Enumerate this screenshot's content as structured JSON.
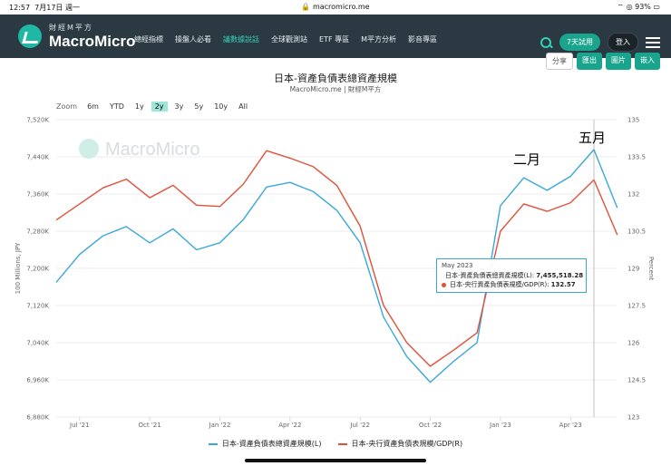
{
  "status": {
    "time": "12:57",
    "date": "7月17日 週一",
    "url": "macromicro.me",
    "battery": "93%"
  },
  "nav": {
    "brand_cn": "財經M平方",
    "brand_en": "MacroMicro",
    "menu": [
      "總經指標",
      "操盤人必看",
      "議數據說話",
      "全球觀測站",
      "ETF 專區",
      "M平方分析",
      "影音專區"
    ],
    "trial_label": "7天試用",
    "login_label": "登入"
  },
  "toolbar": {
    "share": "分享",
    "export": "匯出",
    "image": "圖片",
    "embed": "嵌入"
  },
  "zoom": {
    "label": "Zoom",
    "options": [
      "6m",
      "YTD",
      "1y",
      "2y",
      "3y",
      "5y",
      "10y",
      "All"
    ],
    "selected": "2y"
  },
  "watermark": "MacroMicro",
  "annotations": {
    "feb": "二月",
    "may": "五月"
  },
  "tooltip": {
    "date": "May 2023",
    "row1_label": "日本-資產負債表總資產規模(L): ",
    "row1_value": "7,455,518.28",
    "row2_label": "日本-央行資產負債表規模/GDP(R): ",
    "row2_value": "132.57"
  },
  "colors": {
    "series_left": "#3aa7d9",
    "series_right": "#e0503a",
    "accent": "#1aa48e",
    "nav_bg": "#2b3a42"
  },
  "chart_data": {
    "type": "line",
    "title": "日本-資產負債表總資產規模",
    "subtitle": "MacroMicro.me | 財經M平方",
    "ylabel_left": "100 Millions, JPY",
    "ylabel_right": "Percent",
    "x_ticks": [
      "Jul '21",
      "Oct '21",
      "Jan '22",
      "Apr '22",
      "Jul '22",
      "Oct '22",
      "Jan '23",
      "Apr '23"
    ],
    "x_start": "2021-06",
    "ylim_left": [
      6880000,
      7520000
    ],
    "yticks_left": [
      "6,880K",
      "6,960K",
      "7,040K",
      "7,120K",
      "7,200K",
      "7,280K",
      "7,360K",
      "7,440K",
      "7,520K"
    ],
    "ylim_right": [
      123,
      135
    ],
    "yticks_right": [
      "123",
      "124.5",
      "126",
      "127.5",
      "129",
      "130.5",
      "132",
      "133.5",
      "135"
    ],
    "series": [
      {
        "name": "日本-資產負債表總資產規模(L)",
        "axis": "left",
        "x": [
          "2021-06",
          "2021-07",
          "2021-08",
          "2021-09",
          "2021-10",
          "2021-11",
          "2021-12",
          "2022-01",
          "2022-02",
          "2022-03",
          "2022-04",
          "2022-05",
          "2022-06",
          "2022-07",
          "2022-08",
          "2022-09",
          "2022-10",
          "2022-11",
          "2022-12",
          "2023-01",
          "2023-02",
          "2023-03",
          "2023-04",
          "2023-05",
          "2023-06"
        ],
        "values": [
          7170000,
          7230000,
          7270000,
          7290000,
          7255000,
          7285000,
          7240000,
          7255000,
          7305000,
          7375000,
          7385000,
          7365000,
          7325000,
          7255000,
          7095000,
          7010000,
          6955000,
          7000000,
          7040000,
          7335000,
          7395000,
          7368000,
          7398000,
          7455518.28,
          7330000
        ]
      },
      {
        "name": "日本-央行資產負債表規模/GDP(R)",
        "axis": "right",
        "x": [
          "2021-06",
          "2021-07",
          "2021-08",
          "2021-09",
          "2021-10",
          "2021-11",
          "2021-12",
          "2022-01",
          "2022-02",
          "2022-03",
          "2022-04",
          "2022-05",
          "2022-06",
          "2022-07",
          "2022-08",
          "2022-09",
          "2022-10",
          "2022-11",
          "2022-12",
          "2023-01",
          "2023-02",
          "2023-03",
          "2023-04",
          "2023-05",
          "2023-06"
        ],
        "values": [
          130.95,
          131.6,
          132.25,
          132.6,
          131.85,
          132.35,
          131.55,
          131.5,
          132.4,
          133.75,
          133.45,
          133.1,
          132.35,
          130.7,
          127.5,
          126.0,
          125.05,
          125.7,
          126.4,
          130.5,
          131.6,
          131.3,
          131.65,
          132.57,
          130.35
        ]
      }
    ]
  }
}
